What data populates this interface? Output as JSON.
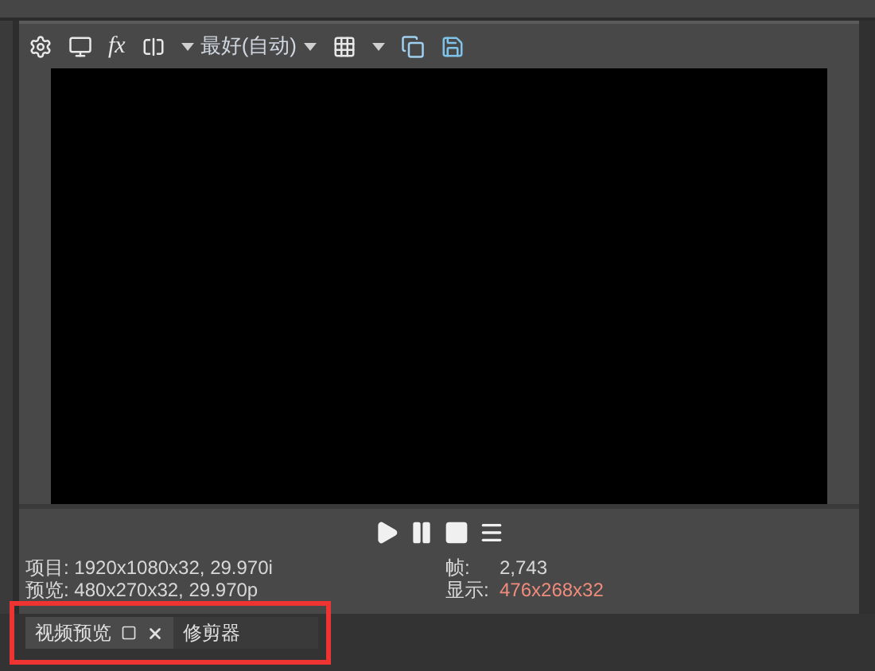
{
  "toolbar": {
    "fx_label": "fx",
    "quality": "最好(自动)"
  },
  "transport": [
    {
      "kind": "play"
    },
    {
      "kind": "pause"
    },
    {
      "kind": "stop"
    },
    {
      "kind": "menu"
    }
  ],
  "info_left": [
    "项目: 1920x1080x32, 29.970i",
    "预览: 480x270x32, 29.970p"
  ],
  "info_right": [
    {
      "label": "帧:",
      "value": "2,743",
      "highlight": false
    },
    {
      "label": "显示:",
      "value": "476x268x32",
      "highlight": true
    }
  ],
  "tabs": [
    {
      "label": "视频预览",
      "selected": true
    },
    {
      "label": "修剪器",
      "selected": false
    }
  ]
}
